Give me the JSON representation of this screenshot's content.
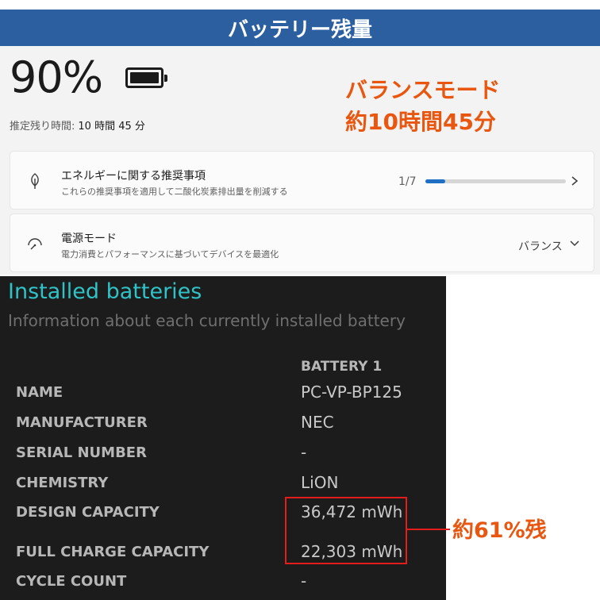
{
  "banner": {
    "title": "バッテリー残量"
  },
  "windows_panel": {
    "percent": "90%",
    "estimate_label": "推定残り時間:",
    "estimate_value": "10 時間 45 分",
    "recommendation_card": {
      "title": "エネルギーに関する推奨事項",
      "subtitle": "これらの推奨事項を適用して二酸化炭素排出量を削減する",
      "progress_text": "1/7",
      "progress_fraction": 0.142
    },
    "power_mode_card": {
      "title": "電源モード",
      "subtitle": "電力消費とパフォーマンスに基づいてデバイスを最適化",
      "value": "バランス"
    }
  },
  "annotation": {
    "mode_line": "バランスモード",
    "time_line": "約10時間45分",
    "capacity_note": "約61%残"
  },
  "battery_report": {
    "title": "Installed batteries",
    "subtitle": "Information about each currently installed battery",
    "column_header": "BATTERY 1",
    "rows": [
      {
        "label": "NAME",
        "value": "PC-VP-BP125"
      },
      {
        "label": "MANUFACTURER",
        "value": "NEC"
      },
      {
        "label": "SERIAL NUMBER",
        "value": "-"
      },
      {
        "label": "CHEMISTRY",
        "value": "LiON"
      },
      {
        "label": "DESIGN CAPACITY",
        "value": "36,472 mWh"
      },
      {
        "label": "FULL CHARGE CAPACITY",
        "value": "22,303 mWh"
      },
      {
        "label": "CYCLE COUNT",
        "value": "-"
      }
    ]
  },
  "colors": {
    "banner_bg": "#2c5fa0",
    "annotation_orange": "#e8560f",
    "highlight_red": "#e31c1c",
    "report_title_teal": "#2fc3c8",
    "progress_blue": "#1f6fc5"
  },
  "icons": {
    "battery": "battery-full-icon",
    "recommendation": "leaf-icon",
    "power_mode": "gauge-icon",
    "expand": "chevron-right-icon",
    "dropdown": "chevron-down-icon"
  }
}
